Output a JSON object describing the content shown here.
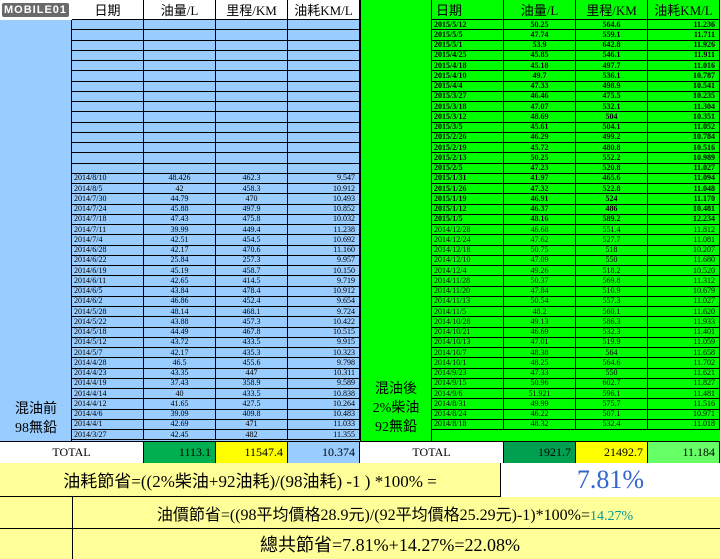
{
  "brand": {
    "logo_text": "MOBILE01"
  },
  "left_table": {
    "headers": [
      "日期",
      "油量/L",
      "里程/KM",
      "油耗KM/L"
    ],
    "side_label_line1": "混油前",
    "side_label_line2": "98無鉛",
    "rows": [
      [
        "2014/8/10",
        "48.426",
        "462.3",
        "9.547"
      ],
      [
        "2014/8/5",
        "42",
        "458.3",
        "10.912"
      ],
      [
        "2014/7/30",
        "44.79",
        "470",
        "10.493"
      ],
      [
        "2014/7/24",
        "45.88",
        "497.9",
        "10.852"
      ],
      [
        "2014/7/18",
        "47.43",
        "475.8",
        "10.032"
      ],
      [
        "2014/7/11",
        "39.99",
        "449.4",
        "11.238"
      ],
      [
        "2014/7/4",
        "42.51",
        "454.5",
        "10.692"
      ],
      [
        "2014/6/28",
        "42.17",
        "470.6",
        "11.160"
      ],
      [
        "2014/6/22",
        "25.84",
        "257.3",
        "9.957"
      ],
      [
        "2014/6/19",
        "45.19",
        "458.7",
        "10.150"
      ],
      [
        "2014/6/11",
        "42.65",
        "414.5",
        "9.719"
      ],
      [
        "2014/6/5",
        "43.84",
        "478.4",
        "10.912"
      ],
      [
        "2014/6/2",
        "46.86",
        "452.4",
        "9.654"
      ],
      [
        "2014/5/28",
        "48.14",
        "468.1",
        "9.724"
      ],
      [
        "2014/5/22",
        "43.88",
        "457.3",
        "10.422"
      ],
      [
        "2014/5/18",
        "44.49",
        "467.8",
        "10.515"
      ],
      [
        "2014/5/12",
        "43.72",
        "433.5",
        "9.915"
      ],
      [
        "2014/5/7",
        "42.17",
        "435.3",
        "10.323"
      ],
      [
        "2014/4/28",
        "46.5",
        "455.6",
        "9.798"
      ],
      [
        "2014/4/23",
        "43.35",
        "447",
        "10.311"
      ],
      [
        "2014/4/19",
        "37.43",
        "358.9",
        "9.589"
      ],
      [
        "2014/4/14",
        "40",
        "433.5",
        "10.838"
      ],
      [
        "2014/4/12",
        "41.65",
        "427.5",
        "10.264"
      ],
      [
        "2014/4/6",
        "39.09",
        "409.8",
        "10.483"
      ],
      [
        "2014/4/1",
        "42.69",
        "471",
        "11.033"
      ],
      [
        "2014/3/27",
        "42.45",
        "482",
        "11.355"
      ]
    ],
    "total_label": "TOTAL",
    "total_fuel": "1113.1",
    "total_km": "11547.4",
    "total_avg": "10.374"
  },
  "right_table": {
    "headers": [
      "日期",
      "油量/L",
      "里程/KM",
      "油耗KM/L"
    ],
    "side_label_line1": "混油後",
    "side_label_line2": "2%柴油",
    "side_label_line3": "92無鉛",
    "bold_rows": [
      [
        "2015/5/12",
        "50.25",
        "564.6",
        "11.236"
      ],
      [
        "2015/5/5",
        "47.74",
        "559.1",
        "11.711"
      ],
      [
        "2015/5/1",
        "53.9",
        "642.8",
        "11.926"
      ],
      [
        "2015/4/25",
        "45.85",
        "546.1",
        "11.911"
      ],
      [
        "2015/4/18",
        "45.18",
        "497.7",
        "11.016"
      ],
      [
        "2015/4/10",
        "49.7",
        "536.1",
        "10.787"
      ],
      [
        "2015/4/4",
        "47.33",
        "498.9",
        "10.541"
      ],
      [
        "2015/3/27",
        "46.46",
        "475.5",
        "10.235"
      ],
      [
        "2015/3/18",
        "47.07",
        "532.1",
        "11.304"
      ],
      [
        "2015/3/12",
        "48.69",
        "504",
        "10.351"
      ],
      [
        "2015/3/5",
        "45.61",
        "504.1",
        "11.052"
      ],
      [
        "2015/2/26",
        "46.29",
        "499.2",
        "10.784"
      ],
      [
        "2015/2/19",
        "45.72",
        "480.8",
        "10.516"
      ],
      [
        "2015/2/13",
        "50.25",
        "552.2",
        "10.989"
      ],
      [
        "2015/2/5",
        "47.23",
        "520.8",
        "11.027"
      ],
      [
        "2015/1/31",
        "41.97",
        "465.6",
        "11.094"
      ],
      [
        "2015/1/26",
        "47.32",
        "522.8",
        "11.048"
      ],
      [
        "2015/1/19",
        "46.91",
        "524",
        "11.170"
      ],
      [
        "2015/1/12",
        "46.37",
        "486",
        "10.481"
      ],
      [
        "2015/1/5",
        "48.16",
        "589.2",
        "12.234"
      ]
    ],
    "rows": [
      [
        "2014/12/28",
        "46.68",
        "551.4",
        "11.812"
      ],
      [
        "2014/12/24",
        "47.62",
        "527.7",
        "11.081"
      ],
      [
        "2014/12/18",
        "50.75",
        "518",
        "10.207"
      ],
      [
        "2014/12/10",
        "47.09",
        "550",
        "11.680"
      ],
      [
        "2014/12/4",
        "49.26",
        "518.2",
        "10.520"
      ],
      [
        "2014/11/28",
        "50.37",
        "569.8",
        "11.312"
      ],
      [
        "2014/11/20",
        "47.84",
        "510.9",
        "10.679"
      ],
      [
        "2014/11/13",
        "50.54",
        "557.3",
        "11.027"
      ],
      [
        "2014/11/5",
        "48.2",
        "560.1",
        "11.620"
      ],
      [
        "2014/10/28",
        "49.13",
        "586.3",
        "11.933"
      ],
      [
        "2014/10/21",
        "46.69",
        "532.3",
        "11.401"
      ],
      [
        "2014/10/13",
        "47.01",
        "519.9",
        "11.059"
      ],
      [
        "2014/10/7",
        "48.38",
        "564",
        "11.658"
      ],
      [
        "2014/10/1",
        "48.25",
        "564.6",
        "11.702"
      ],
      [
        "2014/9/23",
        "47.33",
        "550",
        "11.621"
      ],
      [
        "2014/9/15",
        "50.96",
        "602.7",
        "11.827"
      ],
      [
        "2014/9/6",
        "51.921",
        "596.1",
        "11.481"
      ],
      [
        "2014/8/31",
        "49.99",
        "575.7",
        "11.516"
      ],
      [
        "2014/8/24",
        "46.22",
        "507.1",
        "10.971"
      ],
      [
        "2014/8/18",
        "48.32",
        "532.4",
        "11.018"
      ]
    ],
    "total_label": "TOTAL",
    "total_fuel": "1921.7",
    "total_km": "21492.7",
    "total_avg": "11.184"
  },
  "summary": {
    "fuel_saving_formula": "油耗節省=((2%柴油+92油耗)/(98油耗) -1 ) *100% =",
    "fuel_saving_value": "7.81%",
    "price_saving_formula": "油價節省=((98平均價格28.9元)/(92平均價格25.29元)-1)*100%=",
    "price_saving_value": "14.27%",
    "total_saving": "總共節省=7.81%+14.27%=22.08%"
  },
  "colors": {
    "left_bg": "#99ccff",
    "right_bg": "#00ff00",
    "summary_bg": "#ffff99",
    "total_green": "#00b050",
    "total_yellow": "#ffff00",
    "total_light_green": "#66ff66",
    "total_dark_green": "#00a050",
    "highlight_blue": "#3366cc",
    "highlight_teal": "#009999"
  }
}
